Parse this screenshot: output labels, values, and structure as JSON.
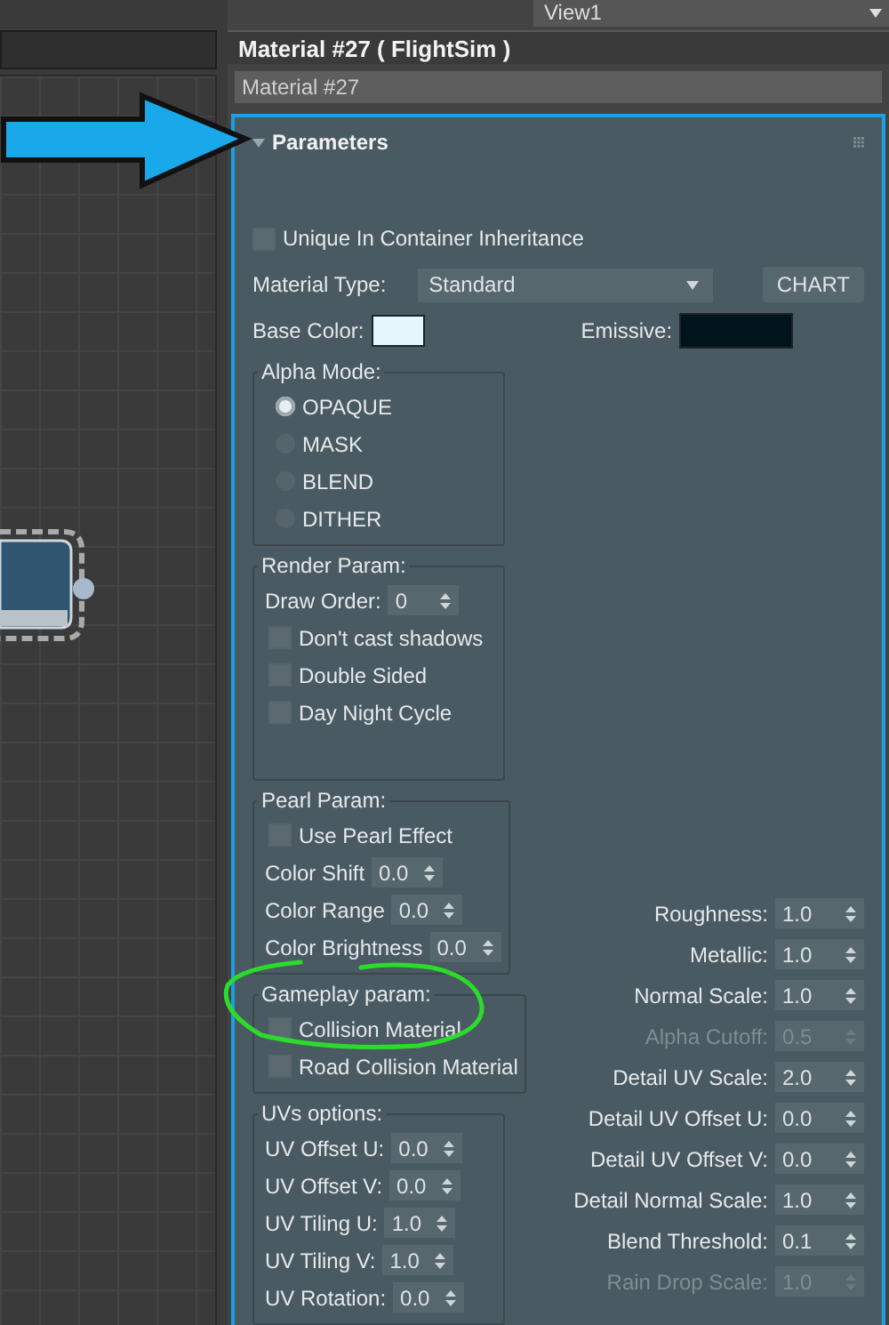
{
  "view_selector": {
    "value": "View1"
  },
  "material_window": {
    "title": "Material #27  ( FlightSim )",
    "name_field": {
      "value": "Material #27"
    },
    "rollout": {
      "title": "Parameters",
      "expanded": true,
      "unique_in_container": {
        "label": "Unique In Container Inheritance",
        "checked": false
      },
      "material_type": {
        "label": "Material Type:",
        "value": "Standard"
      },
      "chart_button": "CHART",
      "base_color": {
        "label": "Base Color:",
        "color": "#e6f6fd"
      },
      "emissive": {
        "label": "Emissive:",
        "color": "#02141b"
      },
      "groups": [
        {
          "title": "Alpha Mode:",
          "items": [
            {
              "kind": "radio",
              "label": "OPAQUE",
              "selected": true
            },
            {
              "kind": "radio",
              "label": "MASK",
              "selected": false
            },
            {
              "kind": "radio",
              "label": "BLEND",
              "selected": false
            },
            {
              "kind": "radio",
              "label": "DITHER",
              "selected": false
            }
          ]
        },
        {
          "title": "Render Param:",
          "items": [
            {
              "kind": "spinner",
              "label": "Draw Order:",
              "value": "0"
            },
            {
              "kind": "checkbox",
              "label": "Don't cast shadows",
              "checked": false
            },
            {
              "kind": "checkbox",
              "label": "Double Sided",
              "checked": false
            },
            {
              "kind": "checkbox",
              "label": "Day Night Cycle",
              "checked": false
            }
          ]
        },
        {
          "title": "Pearl Param:",
          "items": [
            {
              "kind": "checkbox",
              "label": "Use Pearl Effect",
              "checked": false
            },
            {
              "kind": "spinner",
              "label": "Color Shift",
              "value": "0.0"
            },
            {
              "kind": "spinner",
              "label": "Color Range",
              "value": "0.0"
            },
            {
              "kind": "spinner",
              "label": "Color Brightness",
              "value": "0.0"
            }
          ]
        },
        {
          "title": "Gameplay param:",
          "items": [
            {
              "kind": "checkbox",
              "label": "Collision Material",
              "checked": false
            },
            {
              "kind": "checkbox",
              "label": "Road Collision Material",
              "checked": false
            }
          ]
        },
        {
          "title": "UVs options:",
          "items": [
            {
              "kind": "spinner",
              "label": "UV Offset U:",
              "value": "0.0"
            },
            {
              "kind": "spinner",
              "label": "UV Offset V:",
              "value": "0.0"
            },
            {
              "kind": "spinner",
              "label": "UV Tiling U:",
              "value": "1.0"
            },
            {
              "kind": "spinner",
              "label": "UV Tiling V:",
              "value": "1.0"
            },
            {
              "kind": "spinner",
              "label": "UV Rotation:",
              "value": "0.0"
            }
          ]
        }
      ],
      "properties": [
        {
          "label": "Roughness:",
          "value": "1.0",
          "disabled": false
        },
        {
          "label": "Metallic:",
          "value": "1.0",
          "disabled": false
        },
        {
          "label": "Normal Scale:",
          "value": "1.0",
          "disabled": false
        },
        {
          "label": "Alpha Cutoff:",
          "value": "0.5",
          "disabled": true
        },
        {
          "label": "Detail UV Scale:",
          "value": "2.0",
          "disabled": false
        },
        {
          "label": "Detail UV Offset U:",
          "value": "0.0",
          "disabled": false
        },
        {
          "label": "Detail UV Offset V:",
          "value": "0.0",
          "disabled": false
        },
        {
          "label": "Detail Normal Scale:",
          "value": "1.0",
          "disabled": false
        },
        {
          "label": "Blend Threshold:",
          "value": "0.1",
          "disabled": false
        },
        {
          "label": "Rain Drop Scale:",
          "value": "1.0",
          "disabled": true
        }
      ]
    }
  }
}
